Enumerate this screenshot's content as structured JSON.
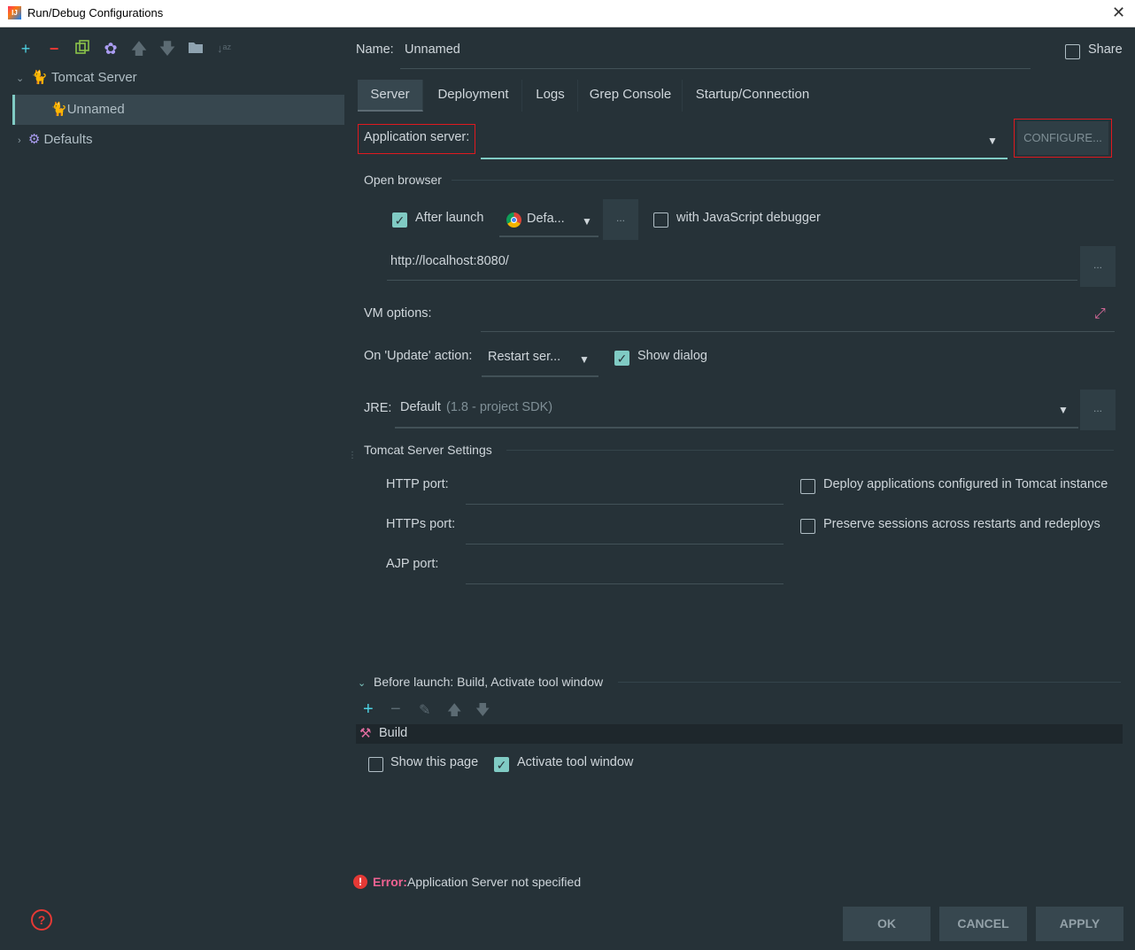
{
  "window": {
    "title": "Run/Debug Configurations"
  },
  "tree": {
    "tomcat_server": "Tomcat Server",
    "unnamed": "Unnamed",
    "defaults": "Defaults"
  },
  "name_field": {
    "label": "Name:",
    "value": "Unnamed"
  },
  "share_label": "Share",
  "tabs": [
    "Server",
    "Deployment",
    "Logs",
    "Grep Console",
    "Startup/Connection"
  ],
  "app_server": {
    "label": "Application server:",
    "value": "",
    "configure_label": "CONFIGURE..."
  },
  "open_browser": {
    "section": "Open browser",
    "after_launch_label": "After launch",
    "after_launch_checked": true,
    "browser_value": "Defa...",
    "js_debugger_label": "with JavaScript debugger",
    "js_debugger_checked": false,
    "url": "http://localhost:8080/"
  },
  "vm_options": {
    "label": "VM options:",
    "value": ""
  },
  "on_update": {
    "label": "On 'Update' action:",
    "value": "Restart ser...",
    "show_dialog_label": "Show dialog",
    "show_dialog_checked": true
  },
  "jre": {
    "label": "JRE:",
    "value": "Default",
    "hint": "(1.8 - project SDK)"
  },
  "tomcat_settings": {
    "section": "Tomcat Server Settings",
    "http_port_label": "HTTP port:",
    "https_port_label": "HTTPs port:",
    "ajp_port_label": "AJP port:",
    "deploy_label": "Deploy applications configured in Tomcat instance",
    "preserve_label": "Preserve sessions across restarts and redeploys"
  },
  "before_launch": {
    "header": "Before launch: Build, Activate tool window",
    "items": [
      "Build"
    ],
    "show_page_label": "Show this page",
    "show_page_checked": false,
    "activate_label": "Activate tool window",
    "activate_checked": true
  },
  "error": {
    "prefix": "Error:",
    "message": "Application Server not specified"
  },
  "buttons": {
    "ok": "OK",
    "cancel": "CANCEL",
    "apply": "APPLY"
  },
  "colors": {
    "background": "#263238",
    "accent": "#80cbc4",
    "selection": "#37474f",
    "error": "#e53935",
    "highlight_box": "#e0191f"
  }
}
